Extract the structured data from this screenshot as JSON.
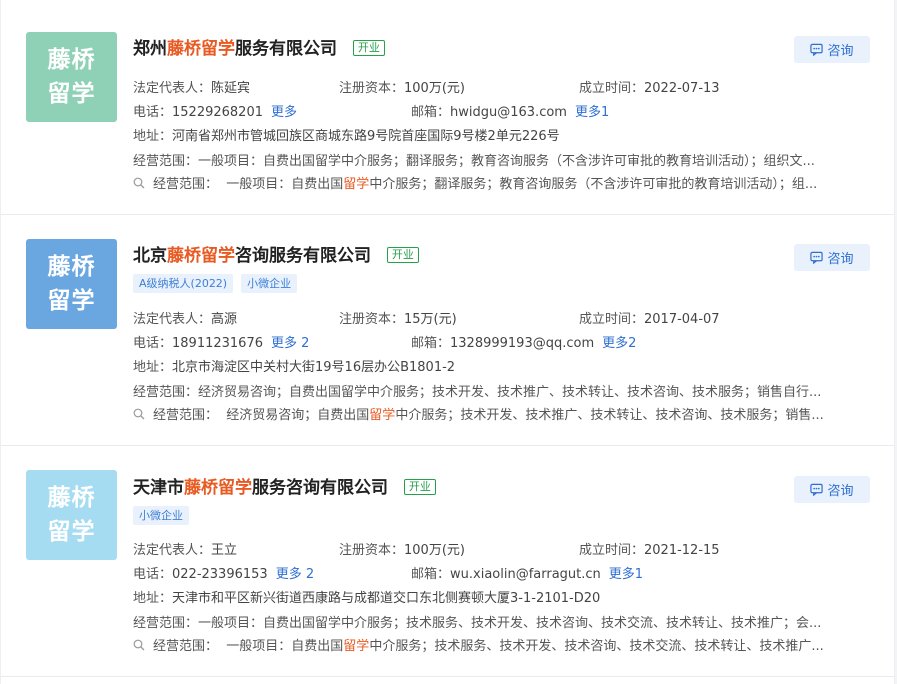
{
  "companies": [
    {
      "logo_line1": "藤桥",
      "logo_line2": "留学",
      "logo_color": "#8fd1b7",
      "name_prefix": "郑州",
      "name_highlight": "藤桥留学",
      "name_suffix": "服务有限公司",
      "status": "开业",
      "tags": [],
      "consult_label": "咨询",
      "legal_rep_label": "法定代表人：",
      "legal_rep": "陈延宾",
      "capital_label": "注册资本：",
      "capital": "100万(元)",
      "founded_label": "成立时间：",
      "founded": "2022-07-13",
      "phone_label": "电话：",
      "phone": "15229268201",
      "phone_more": "更多",
      "email_label": "邮箱：",
      "email": "hwidgu@163.com",
      "email_more": "更多1",
      "address_label": "地址：",
      "address": "河南省郑州市管城回族区商城东路9号院首座国际9号楼2单元226号",
      "scope_label": "经营范围：",
      "scope": "一般项目：自费出国留学中介服务；翻译服务；教育咨询服务（不含涉许可审批的教育培训活动）；组织文...",
      "scope_match_label": "经营范围：",
      "scope_match_pre": "一般项目：自费出国",
      "scope_match_hl": "留学",
      "scope_match_post": "中介服务；翻译服务；教育咨询服务（不含涉许可审批的教育培训活动）；组..."
    },
    {
      "logo_line1": "藤桥",
      "logo_line2": "留学",
      "logo_color": "#6aa6e0",
      "name_prefix": "北京",
      "name_highlight": "藤桥留学",
      "name_suffix": "咨询服务有限公司",
      "status": "开业",
      "tags": [
        "A级纳税人(2022)",
        "小微企业"
      ],
      "consult_label": "咨询",
      "legal_rep_label": "法定代表人：",
      "legal_rep": "高源",
      "capital_label": "注册资本：",
      "capital": "15万(元)",
      "founded_label": "成立时间：",
      "founded": "2017-04-07",
      "phone_label": "电话：",
      "phone": "18911231676",
      "phone_more": "更多 2",
      "email_label": "邮箱：",
      "email": "1328999193@qq.com",
      "email_more": "更多2",
      "address_label": "地址：",
      "address": "北京市海淀区中关村大街19号16层办公B1801-2",
      "scope_label": "经营范围：",
      "scope": "经济贸易咨询；自费出国留学中介服务；技术开发、技术推广、技术转让、技术咨询、技术服务；销售自行...",
      "scope_match_label": "经营范围：",
      "scope_match_pre": "经济贸易咨询；自费出国",
      "scope_match_hl": "留学",
      "scope_match_post": "中介服务；技术开发、技术推广、技术转让、技术咨询、技术服务；销售..."
    },
    {
      "logo_line1": "藤桥",
      "logo_line2": "留学",
      "logo_color": "#a6dcf1",
      "name_prefix": "天津市",
      "name_highlight": "藤桥留学",
      "name_suffix": "服务咨询有限公司",
      "status": "开业",
      "tags": [
        "小微企业"
      ],
      "consult_label": "咨询",
      "legal_rep_label": "法定代表人：",
      "legal_rep": "王立",
      "capital_label": "注册资本：",
      "capital": "100万(元)",
      "founded_label": "成立时间：",
      "founded": "2021-12-15",
      "phone_label": "电话：",
      "phone": "022-23396153",
      "phone_more": "更多 2",
      "email_label": "邮箱：",
      "email": "wu.xiaolin@farragut.cn",
      "email_more": "更多1",
      "address_label": "地址：",
      "address": "天津市和平区新兴街道西康路与成都道交口东北侧赛顿大厦3-1-2101-D20",
      "scope_label": "经营范围：",
      "scope": "一般项目：自费出国留学中介服务；技术服务、技术开发、技术咨询、技术交流、技术转让、技术推广；会...",
      "scope_match_label": "经营范围：",
      "scope_match_pre": "一般项目：自费出国",
      "scope_match_hl": "留学",
      "scope_match_post": "中介服务；技术服务、技术开发、技术咨询、技术交流、技术转让、技术推广..."
    }
  ]
}
